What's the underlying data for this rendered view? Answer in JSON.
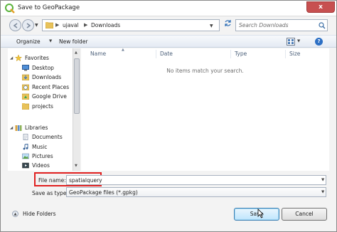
{
  "window": {
    "title": "Save to GeoPackage",
    "close_label": "x"
  },
  "address": {
    "segments": [
      "ujaval",
      "Downloads"
    ],
    "separator": "▶"
  },
  "search": {
    "placeholder": "Search Downloads"
  },
  "toolbar": {
    "organize_label": "Organize",
    "new_folder_label": "New folder",
    "help_label": "?"
  },
  "nav": {
    "favorites": {
      "label": "Favorites",
      "items": [
        "Desktop",
        "Downloads",
        "Recent Places",
        "Google Drive",
        "projects"
      ]
    },
    "libraries": {
      "label": "Libraries",
      "items": [
        "Documents",
        "Music",
        "Pictures",
        "Videos"
      ]
    }
  },
  "file_list": {
    "columns": [
      "Name",
      "Date",
      "Type",
      "Size"
    ],
    "empty_message": "No items match your search."
  },
  "form": {
    "file_name_label": "File name:",
    "file_name_value": "spatialquery",
    "save_as_type_label": "Save as type:",
    "save_as_type_value": "GeoPackage files (*.gpkg)"
  },
  "footer": {
    "hide_folders_label": "Hide Folders",
    "save_label": "Save",
    "cancel_label": "Cancel"
  },
  "colors": {
    "highlight_border": "#e02020",
    "accent": "#2c6fc4",
    "folder": "#e8c25a"
  }
}
